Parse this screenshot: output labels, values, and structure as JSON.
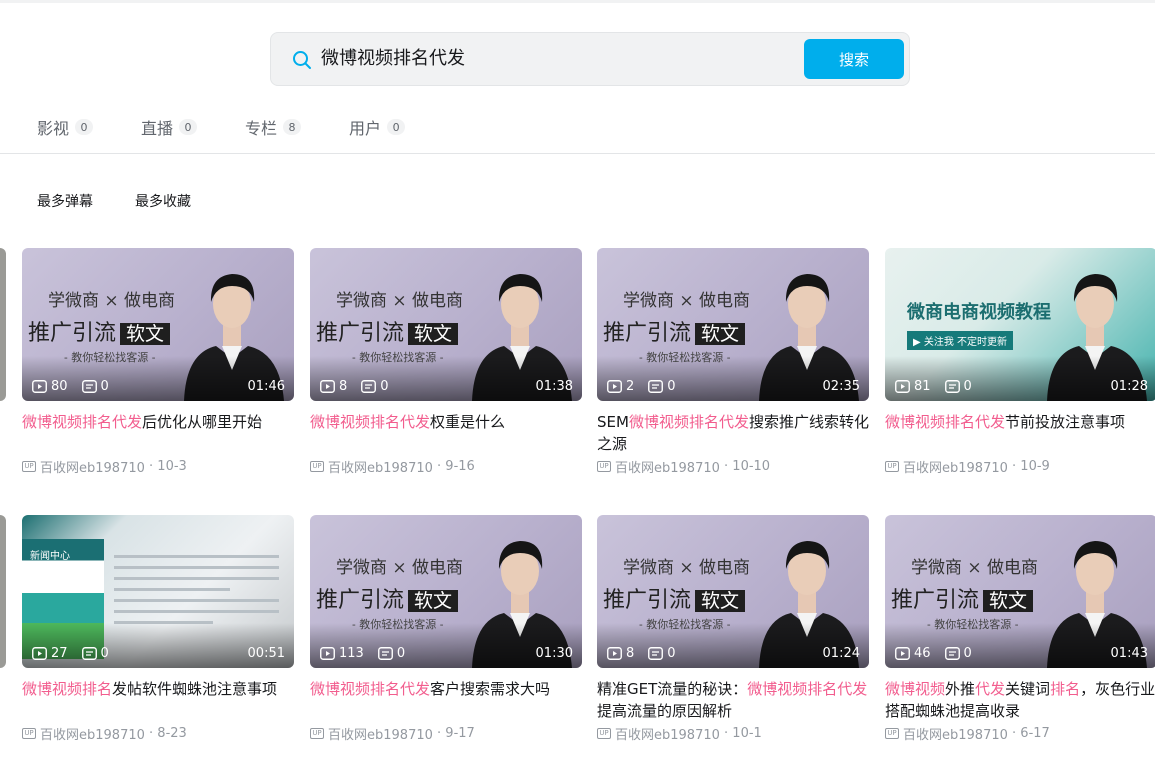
{
  "search": {
    "query": "微博视频排名代发",
    "button_label": "搜索"
  },
  "tabs": [
    {
      "label": "影视",
      "count": "0"
    },
    {
      "label": "直播",
      "count": "0"
    },
    {
      "label": "专栏",
      "count": "8"
    },
    {
      "label": "用户",
      "count": "0"
    }
  ],
  "filters": [
    "最多弹幕",
    "最多收藏"
  ],
  "thumb_text": {
    "line1": "学微商 × 做电商",
    "line2_a": "推广引流",
    "line2_b": "软文",
    "line3": "- 教你轻松找客源 -",
    "teal_title": "微商电商视频教程",
    "teal_sub": "▶ 关注我 不定时更新",
    "screen_nav": "新闻中心"
  },
  "videos": [
    {
      "plays": "80",
      "danmaku": "0",
      "duration": "01:46",
      "title_parts": [
        {
          "t": "微博视频排名代发",
          "hl": true
        },
        {
          "t": "后优化从哪里开始",
          "hl": false
        }
      ],
      "author": "百收网eb198710",
      "date": "10-3",
      "thumb": "purple"
    },
    {
      "plays": "8",
      "danmaku": "0",
      "duration": "01:38",
      "title_parts": [
        {
          "t": "微博视频排名代发",
          "hl": true
        },
        {
          "t": "权重是什么",
          "hl": false
        }
      ],
      "author": "百收网eb198710",
      "date": "9-16",
      "thumb": "purple"
    },
    {
      "plays": "2",
      "danmaku": "0",
      "duration": "02:35",
      "title_parts": [
        {
          "t": "SEM",
          "hl": false
        },
        {
          "t": "微博视频排名代发",
          "hl": true
        },
        {
          "t": "搜索推广线索转化之源",
          "hl": false
        }
      ],
      "author": "百收网eb198710",
      "date": "10-10",
      "thumb": "purple"
    },
    {
      "plays": "81",
      "danmaku": "0",
      "duration": "01:28",
      "title_parts": [
        {
          "t": "微博视频排名代发",
          "hl": true
        },
        {
          "t": "节前投放注意事项",
          "hl": false
        }
      ],
      "author": "百收网eb198710",
      "date": "10-9",
      "thumb": "teal"
    },
    {
      "plays": "27",
      "danmaku": "0",
      "duration": "00:51",
      "title_parts": [
        {
          "t": "微博视频排名",
          "hl": true
        },
        {
          "t": "发帖软件蜘蛛池注意事项",
          "hl": false
        }
      ],
      "author": "百收网eb198710",
      "date": "8-23",
      "thumb": "screen"
    },
    {
      "plays": "113",
      "danmaku": "0",
      "duration": "01:30",
      "title_parts": [
        {
          "t": "微博视频排名代发",
          "hl": true
        },
        {
          "t": "客户搜索需求大吗",
          "hl": false
        }
      ],
      "author": "百收网eb198710",
      "date": "9-17",
      "thumb": "purple"
    },
    {
      "plays": "8",
      "danmaku": "0",
      "duration": "01:24",
      "title_parts": [
        {
          "t": "精准GET流量的秘诀：",
          "hl": false
        },
        {
          "t": "微博视频排名代发",
          "hl": true
        },
        {
          "t": "提高流量的原因解析",
          "hl": false
        }
      ],
      "author": "百收网eb198710",
      "date": "10-1",
      "thumb": "purple"
    },
    {
      "plays": "46",
      "danmaku": "0",
      "duration": "01:43",
      "title_parts": [
        {
          "t": "微博视频",
          "hl": true
        },
        {
          "t": "外推",
          "hl": false
        },
        {
          "t": "代发",
          "hl": true
        },
        {
          "t": "关键词",
          "hl": false
        },
        {
          "t": "排名",
          "hl": true
        },
        {
          "t": "，灰色行业搭配蜘蛛池提高收录",
          "hl": false
        }
      ],
      "author": "百收网eb198710",
      "date": "6-17",
      "thumb": "purple"
    }
  ],
  "colors": {
    "accent": "#00aeec",
    "highlight": "#f25d8e",
    "meta": "#9499a0"
  }
}
